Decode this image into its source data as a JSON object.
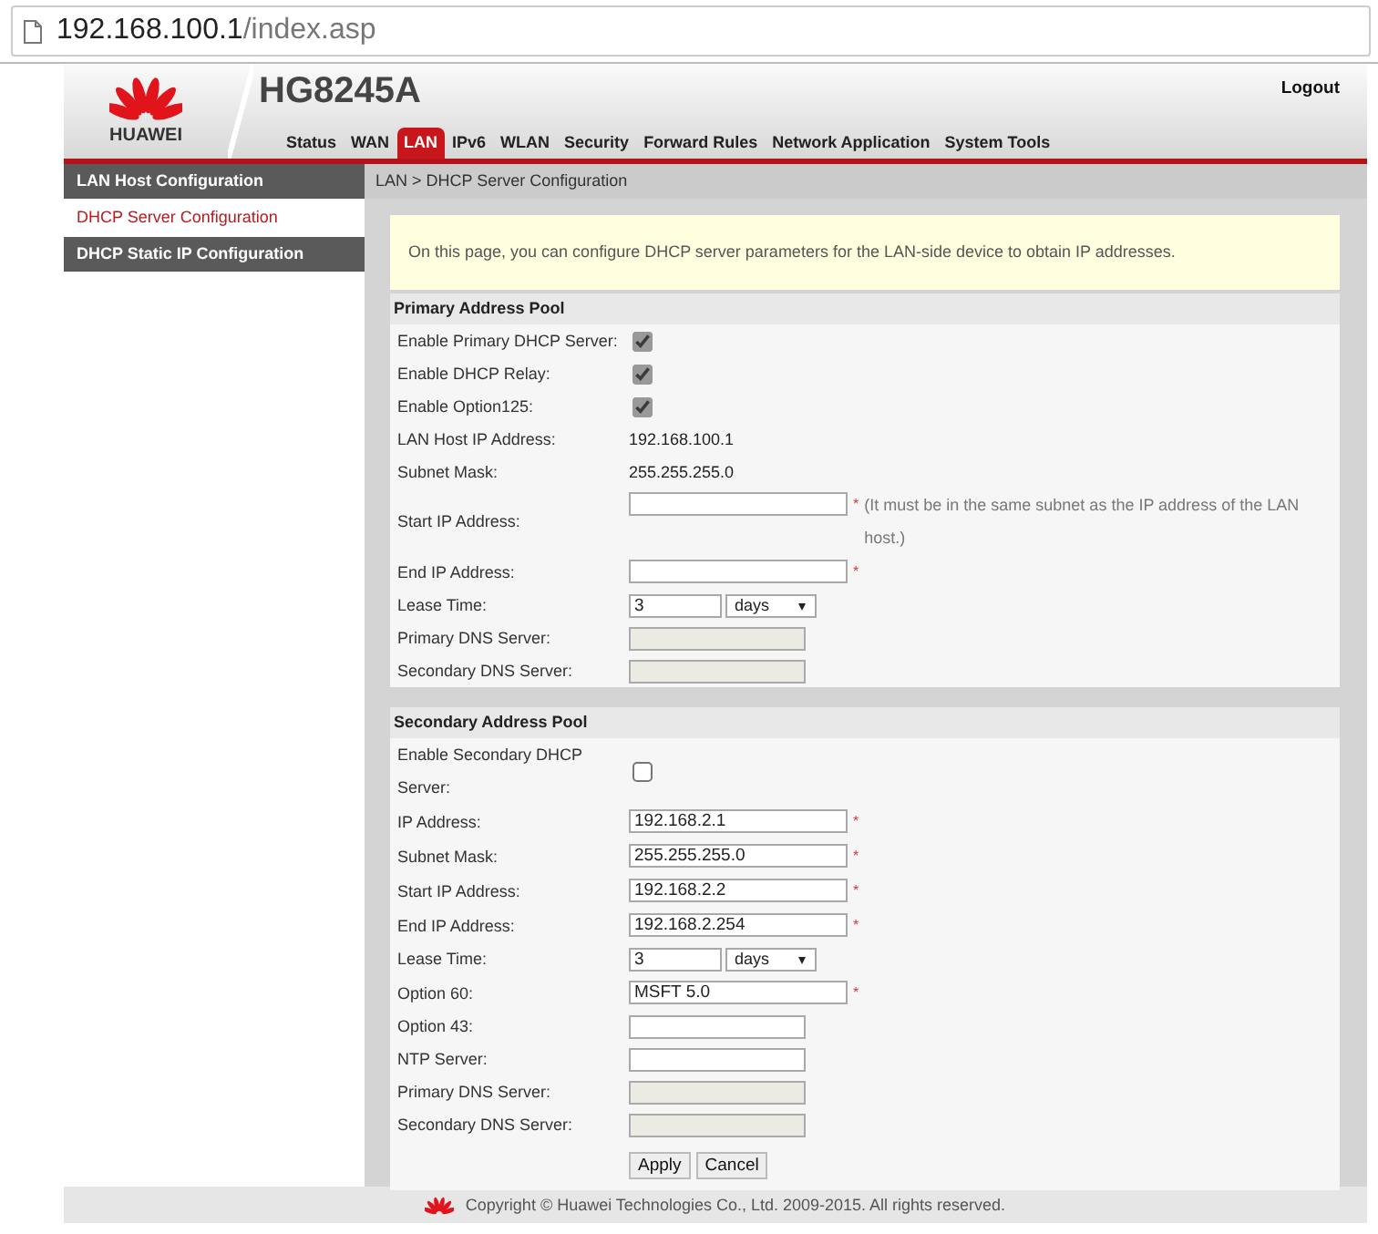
{
  "address_bar": {
    "host": "192.168.100.1",
    "path": "/index.asp"
  },
  "header": {
    "brand": "HUAWEI",
    "model": "HG8245A",
    "logout": "Logout"
  },
  "tabs": [
    {
      "label": "Status",
      "selected": false
    },
    {
      "label": "WAN",
      "selected": false
    },
    {
      "label": "LAN",
      "selected": true
    },
    {
      "label": "IPv6",
      "selected": false
    },
    {
      "label": "WLAN",
      "selected": false
    },
    {
      "label": "Security",
      "selected": false
    },
    {
      "label": "Forward Rules",
      "selected": false
    },
    {
      "label": "Network Application",
      "selected": false
    },
    {
      "label": "System Tools",
      "selected": false
    }
  ],
  "sidebar": {
    "items": [
      {
        "label": "LAN Host Configuration",
        "selected": false
      },
      {
        "label": "DHCP Server Configuration",
        "selected": true
      },
      {
        "label": "DHCP Static IP Configuration",
        "selected": false
      }
    ]
  },
  "breadcrumb": "LAN > DHCP Server Configuration",
  "notice": "On this page, you can configure DHCP server parameters for the LAN-side device to obtain IP addresses.",
  "sections": [
    {
      "title": "Primary Address Pool",
      "rows": [
        {
          "kind": "checkbox",
          "label": "Enable Primary DHCP Server:",
          "checked": true
        },
        {
          "kind": "checkbox",
          "label": "Enable DHCP Relay:",
          "checked": true
        },
        {
          "kind": "checkbox",
          "label": "Enable Option125:",
          "checked": true
        },
        {
          "kind": "text",
          "label": "LAN Host IP Address:",
          "value": "192.168.100.1"
        },
        {
          "kind": "text",
          "label": "Subnet Mask:",
          "value": "255.255.255.0"
        },
        {
          "kind": "input",
          "label": "Start IP Address:",
          "disabled": false,
          "mark": "*",
          "note": "(It must be in the same subnet as the IP address of the LAN host.)"
        },
        {
          "kind": "input",
          "label": "End IP Address:",
          "disabled": false,
          "mark": "*"
        },
        {
          "kind": "lease",
          "label": "Lease Time:",
          "value": "3",
          "unit": "days"
        },
        {
          "kind": "short_input",
          "label": "Primary DNS Server:",
          "disabled": true
        },
        {
          "kind": "short_input",
          "label": "Secondary DNS Server:",
          "disabled": true
        }
      ]
    },
    {
      "title": "Secondary Address Pool",
      "rows": [
        {
          "kind": "checkbox",
          "label": "Enable Secondary DHCP Server:",
          "checked": false
        },
        {
          "kind": "input",
          "label": "IP Address:",
          "value": "192.168.2.1",
          "disabled": false,
          "mark": "*"
        },
        {
          "kind": "input",
          "label": "Subnet Mask:",
          "value": "255.255.255.0",
          "disabled": false,
          "mark": "*"
        },
        {
          "kind": "input",
          "label": "Start IP Address:",
          "value": "192.168.2.2",
          "disabled": false,
          "mark": "*"
        },
        {
          "kind": "input",
          "label": "End IP Address:",
          "value": "192.168.2.254",
          "disabled": false,
          "mark": "*"
        },
        {
          "kind": "lease",
          "label": "Lease Time:",
          "value": "3",
          "unit": "days"
        },
        {
          "kind": "input",
          "label": "Option 60:",
          "value": "MSFT 5.0",
          "disabled": false,
          "mark": "*"
        },
        {
          "kind": "short_input",
          "label": "Option 43:",
          "disabled": false
        },
        {
          "kind": "short_input",
          "label": "NTP Server:",
          "disabled": false
        },
        {
          "kind": "short_input",
          "label": "Primary DNS Server:",
          "disabled": true
        },
        {
          "kind": "short_input",
          "label": "Secondary DNS Server:",
          "disabled": true
        }
      ]
    }
  ],
  "buttons": [
    "Apply",
    "Cancel"
  ],
  "footer": "Copyright © Huawei Technologies Co., Ltd. 2009-2015. All rights reserved."
}
